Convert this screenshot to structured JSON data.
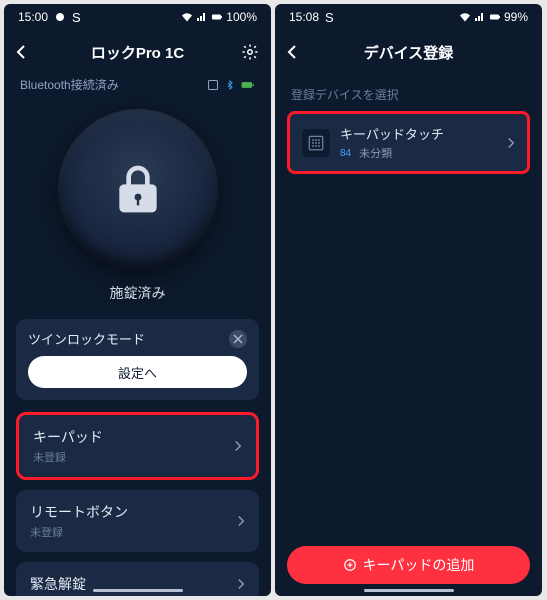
{
  "left": {
    "status": {
      "time": "15:00",
      "battery": "100%"
    },
    "header": {
      "title": "ロックPro 1C"
    },
    "bluetooth_line": "Bluetooth接続済み",
    "lock_status": "施錠済み",
    "twin_mode": {
      "title": "ツインロックモード",
      "button": "設定へ"
    },
    "items": [
      {
        "title": "キーパッド",
        "sub": "未登録",
        "highlight": true
      },
      {
        "title": "リモートボタン",
        "sub": "未登録",
        "highlight": false
      },
      {
        "title": "緊急解錠",
        "sub": "",
        "highlight": false
      }
    ]
  },
  "right": {
    "status": {
      "time": "15:08",
      "battery": "99%"
    },
    "header": {
      "title": "デバイス登録"
    },
    "section_label": "登録デバイスを選択",
    "device": {
      "title": "キーパッドタッチ",
      "sub_prefix": "84",
      "sub": "未分類"
    },
    "add_button": "キーパッドの追加"
  }
}
